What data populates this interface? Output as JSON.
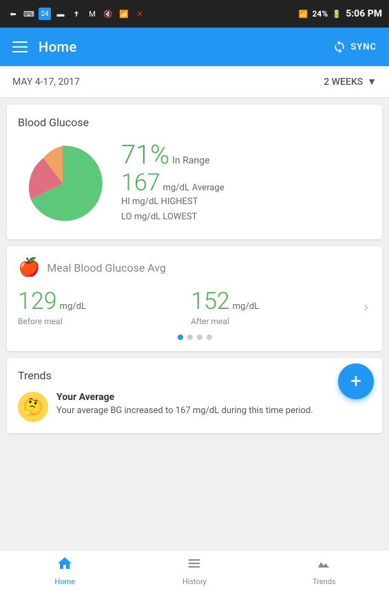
{
  "statusBar": {
    "time": "5:06 PM",
    "battery": "24%"
  },
  "header": {
    "title": "Home",
    "syncLabel": "SYNC",
    "menuIcon": "≡"
  },
  "datePicker": {
    "dateRange": "MAY 4-17, 2017",
    "period": "2 WEEKS"
  },
  "bloodGlucose": {
    "title": "Blood Glucose",
    "percent": "71%",
    "percentLabel": "In Range",
    "average": "167",
    "averageUnit": "mg/dL",
    "averageLabel": "Average",
    "highest": "HI mg/dL HIGHEST",
    "lowest": "LO mg/dL LOWEST",
    "pieColors": {
      "inRange": "#5DC87A",
      "high": "#F4A261",
      "low": "#E07080"
    }
  },
  "mealBloodGlucose": {
    "title": "Meal Blood Glucose",
    "avgLabel": "Avg",
    "beforeVal": "129",
    "beforeUnit": "mg/dL",
    "beforeLabel": "Before meal",
    "afterVal": "152",
    "afterUnit": "mg/dL",
    "afterLabel": "After meal",
    "dots": [
      true,
      false,
      false,
      false
    ]
  },
  "trends": {
    "title": "Trends",
    "fabIcon": "+",
    "item": {
      "title": "Your Average",
      "body": "Your average BG increased to 167 mg/dL during this time period."
    }
  },
  "bottomNav": {
    "items": [
      {
        "label": "Home",
        "active": true,
        "icon": "home"
      },
      {
        "label": "History",
        "active": false,
        "icon": "history"
      },
      {
        "label": "Trends",
        "active": false,
        "icon": "trends"
      }
    ]
  }
}
